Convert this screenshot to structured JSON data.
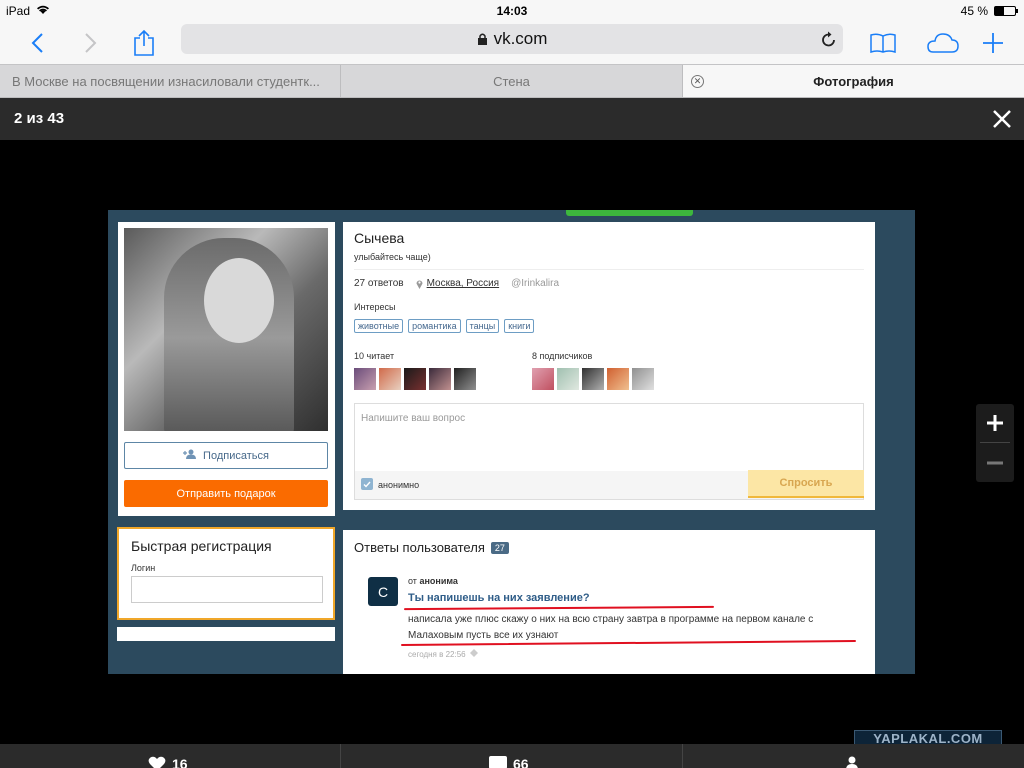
{
  "status": {
    "device": "iPad",
    "time": "14:03",
    "battery": "45 %",
    "battery_level": 0.45
  },
  "browser": {
    "url": "vk.com"
  },
  "tabs": [
    {
      "label": "В Москве на посвящении изнасиловали студентк..."
    },
    {
      "label": "Стена"
    },
    {
      "label": "Фотография"
    }
  ],
  "viewer": {
    "counter": "2 из 43"
  },
  "profile": {
    "name": "Сычева",
    "status": "улыбайтесь чаще)",
    "answers_count": "27 ответов",
    "location": "Москва, Россия",
    "nick": "@Irinkalira",
    "interests_label": "Интересы",
    "interests": [
      "животные",
      "романтика",
      "танцы",
      "книги"
    ],
    "following_label": "10 читает",
    "followers_label": "8 подписчиков",
    "subscribe_label": "Подписаться",
    "gift_label": "Отправить подарок"
  },
  "registration": {
    "title": "Быстрая регистрация",
    "login_label": "Логин"
  },
  "ask": {
    "placeholder": "Напишите ваш вопрос",
    "anon_label": "анонимно",
    "button": "Спросить"
  },
  "answers": {
    "title": "Ответы пользователя",
    "count": "27",
    "item": {
      "avatar_letter": "С",
      "from_prefix": "от",
      "from_name": "анонима",
      "question": "Ты напишешь на них заявление?",
      "text": "написала уже плюс скажу о них на всю страну завтра в программе на первом канале с Малаховым пусть все их узнают",
      "time": "сегодня в 22:56"
    }
  },
  "watermark": "YAPLAKAL.COM",
  "bottom": {
    "likes": "16",
    "comments": "66"
  }
}
